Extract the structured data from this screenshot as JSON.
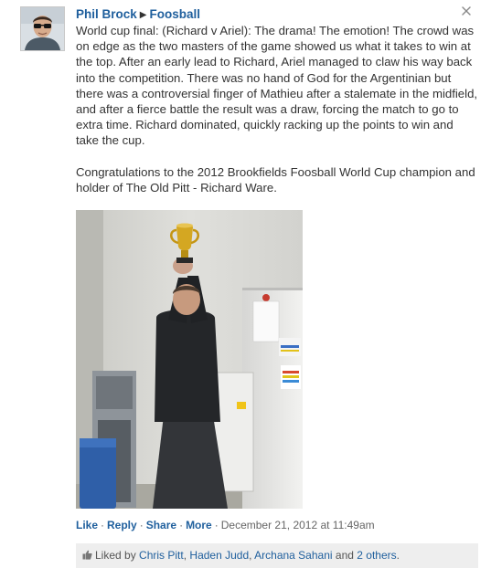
{
  "post": {
    "author": "Phil Brock",
    "group": "Foosball",
    "paragraphs": [
      "World cup final: (Richard v Ariel): The drama! The emotion! The crowd was on edge as the two masters of the game showed us what it takes to win at the top. After an early lead to Richard, Ariel managed to claw his way back into the competition. There was no hand of God for the Argentinian but there was a controversial finger of Mathieu after a stalemate in the midfield, and after a fierce battle the result was a draw, forcing the match to go to extra time. Richard dominated, quickly racking up the points to win and take the cup.",
      "Congratulations to the 2012 Brookfields Foosball World Cup champion and holder of The Old Pitt - Richard Ware."
    ]
  },
  "actions": {
    "like": "Like",
    "reply": "Reply",
    "share": "Share",
    "more": "More",
    "separator": "·",
    "timestamp": "December 21, 2012 at 11:49am"
  },
  "likes": {
    "prefix": "Liked by",
    "names": [
      "Chris Pitt",
      "Haden Judd",
      "Archana Sahani"
    ],
    "conjunction": "and",
    "others": "2 others",
    "suffix": "."
  },
  "icons": {
    "close": "close-icon",
    "thumb": "thumbs-up-icon",
    "arrow": "triangle-right-icon"
  },
  "colors": {
    "link": "#1f5f9d",
    "text": "#333333",
    "likes_bg": "#eeeeee"
  }
}
